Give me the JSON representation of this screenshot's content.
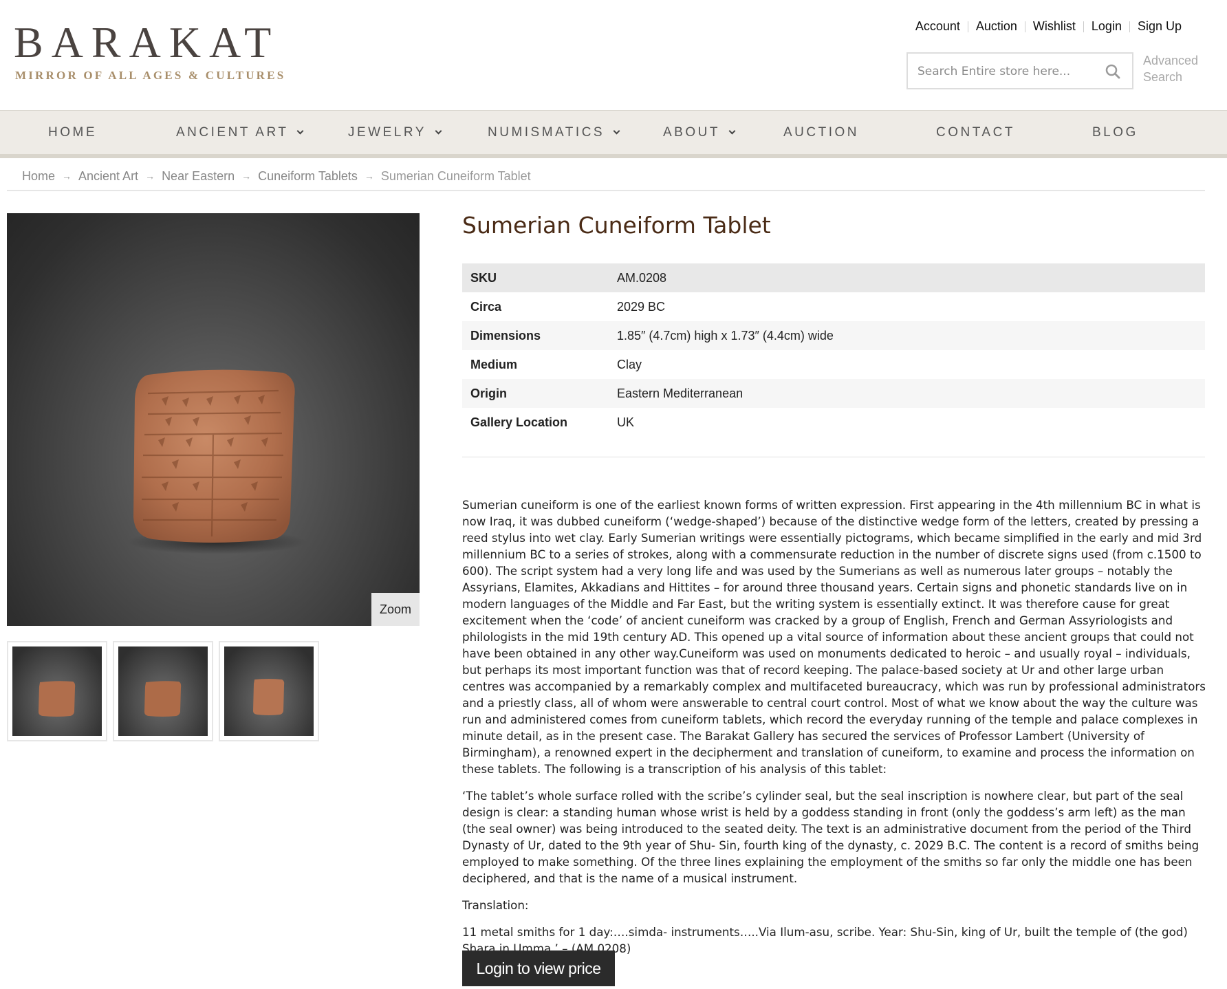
{
  "brand": {
    "name": "BARAKAT",
    "tagline": "MIRROR OF ALL AGES & CULTURES"
  },
  "top_links": [
    "Account",
    "Auction",
    "Wishlist",
    "Login",
    "Sign Up"
  ],
  "search": {
    "placeholder": "Search Entire store here...",
    "advanced_label": "Advanced Search"
  },
  "nav": [
    {
      "label": "HOME",
      "dropdown": false
    },
    {
      "label": "ANCIENT ART",
      "dropdown": true
    },
    {
      "label": "JEWELRY",
      "dropdown": true
    },
    {
      "label": "NUMISMATICS",
      "dropdown": true
    },
    {
      "label": "ABOUT",
      "dropdown": true
    },
    {
      "label": "AUCTION",
      "dropdown": false
    },
    {
      "label": "CONTACT",
      "dropdown": false
    },
    {
      "label": "BLOG",
      "dropdown": false
    }
  ],
  "breadcrumb": [
    "Home",
    "Ancient Art",
    "Near Eastern",
    "Cuneiform Tablets",
    "Sumerian Cuneiform Tablet"
  ],
  "gallery": {
    "zoom_label": "Zoom",
    "thumbnail_count": 3
  },
  "product": {
    "title": "Sumerian Cuneiform Tablet",
    "specs": [
      {
        "key": "SKU",
        "value": "AM.0208"
      },
      {
        "key": "Circa",
        "value": "2029 BC"
      },
      {
        "key": "Dimensions",
        "value": "1.85″ (4.7cm) high x 1.73″ (4.4cm) wide"
      },
      {
        "key": "Medium",
        "value": "Clay"
      },
      {
        "key": "Origin",
        "value": "Eastern Mediterranean"
      },
      {
        "key": "Gallery Location",
        "value": "UK"
      }
    ],
    "description": [
      "Sumerian cuneiform is one of the earliest known forms of written expression. First appearing in the 4th millennium BC in what is now Iraq, it was dubbed cuneiform (‘wedge-shaped’) because of the distinctive wedge form of the letters, created by pressing a reed stylus into wet clay. Early Sumerian writings were essentially pictograms, which became simplified in the early and mid 3rd millennium BC to a series of strokes, along with a commensurate reduction in the number of discrete signs used (from c.1500 to 600). The script system had a very long life and was used by the Sumerians as well as numerous later groups – notably the Assyrians, Elamites, Akkadians and Hittites – for around three thousand years. Certain signs and phonetic standards live on in modern languages of the Middle and Far East, but the writing system is essentially extinct. It was therefore cause for great excitement when the ‘code’ of ancient cuneiform was cracked by a group of English, French and German Assyriologists and philologists in the mid 19th century AD. This opened up a vital source of information about these ancient groups that could not have been obtained in any other way.Cuneiform was used on monuments dedicated to heroic – and usually royal – individuals, but perhaps its most important function was that of record keeping. The palace-based society at Ur and other large urban centres was accompanied by a remarkably complex and multifaceted bureaucracy, which was run by professional administrators and a priestly class, all of whom were answerable to central court control. Most of what we know about the way the culture was run and administered comes from cuneiform tablets, which record the everyday running of the temple and palace complexes in minute detail, as in the present case. The Barakat Gallery has secured the services of Professor Lambert (University of Birmingham), a renowned expert in the decipherment and translation of cuneiform, to examine and process the information on these tablets. The following is a transcription of his analysis of this tablet:",
      "‘The tablet’s whole surface rolled with the scribe’s cylinder seal, but the seal inscription is nowhere clear, but part of the seal design is clear: a standing human whose wrist is held by a goddess standing in front (only the goddess’s arm left) as the man (the seal owner) was being introduced to the seated deity. The text is an administrative document from the period of the Third Dynasty of Ur, dated to the 9th year of Shu- Sin, fourth king of the dynasty, c. 2029 B.C. The content is a record of smiths being employed to make something. Of the three lines explaining the employment of the smiths so far only the middle one has been deciphered, and that is the name of a musical instrument.",
      "Translation:",
      "11 metal smiths for 1 day:….simda- instruments…..Via Ilum-asu, scribe. Year: Shu-Sin, king of Ur, built the temple of (the god) Shara in Umma.’ – (AM.0208)"
    ],
    "price_button": "Login to view price"
  },
  "colors": {
    "logo_text": "#4a4340",
    "logo_tagline": "#a88e6a",
    "nav_bg": "#eeebe6",
    "title": "#4a2b16",
    "button_bg": "#2b2b2b"
  }
}
